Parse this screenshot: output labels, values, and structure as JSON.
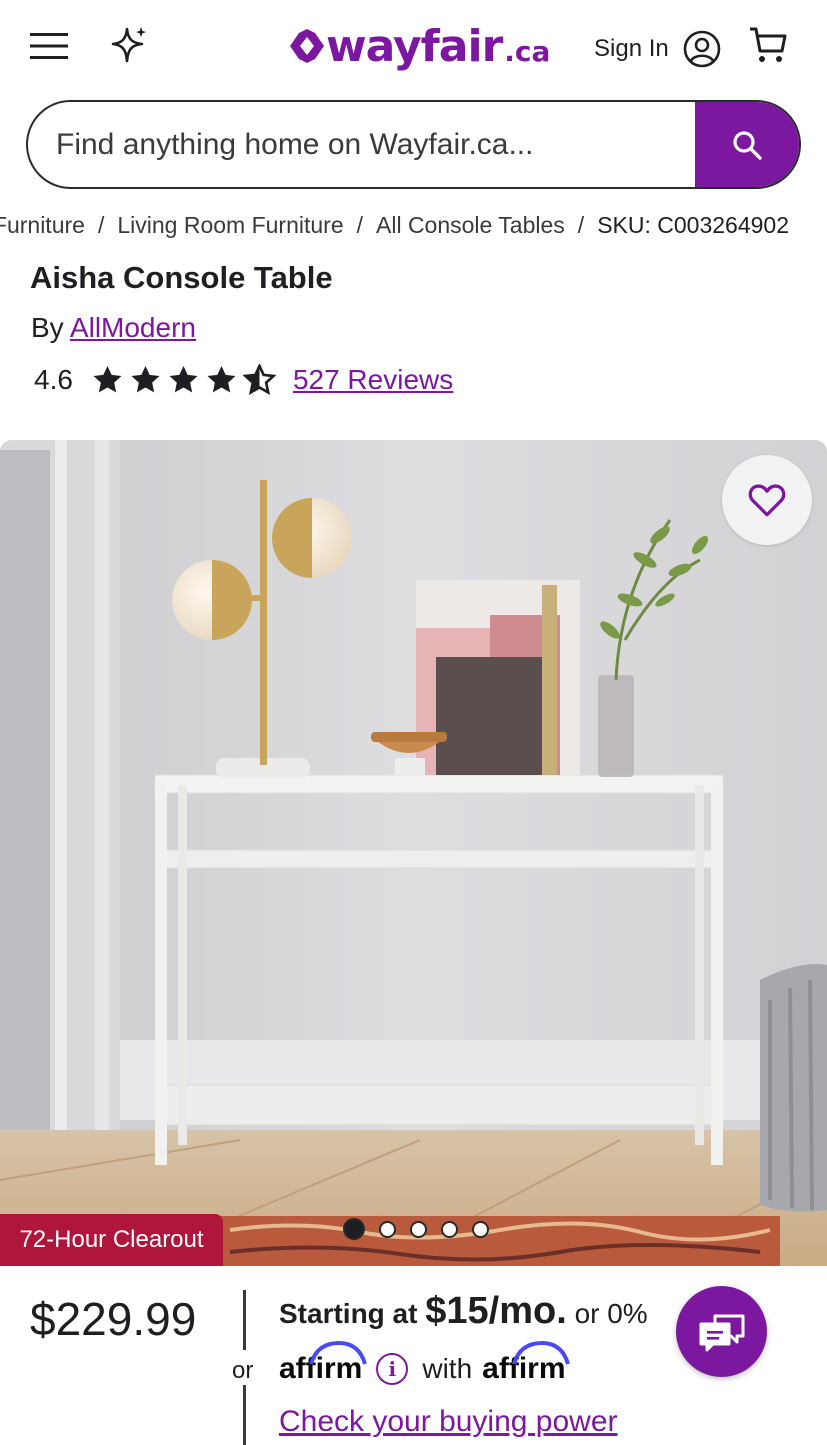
{
  "header": {
    "logo_text": "wayfair",
    "logo_suffix": ".ca",
    "sign_in_label": "Sign In",
    "brand_color": "#7b189f"
  },
  "search": {
    "placeholder": "Find anything home on Wayfair.ca..."
  },
  "breadcrumb": {
    "items": [
      "Furniture",
      "Living Room Furniture",
      "All Console Tables"
    ],
    "sku": "SKU: C003264902"
  },
  "product": {
    "title": "Aisha Console Table",
    "by_label": "By",
    "brand": "AllModern",
    "rating": "4.6",
    "rating_value": 4.6,
    "rating_max": 5,
    "reviews_label": "527 Reviews",
    "badge": "72-Hour Clearout",
    "image_count": 5,
    "active_image": 1
  },
  "pricing": {
    "price": "$229.99",
    "or_label": "or",
    "starting_label": "Starting at",
    "monthly": "$15/mo.",
    "apr_label": "or 0%",
    "affirm_logo": "affirm",
    "with_label": "with",
    "affirm_logo2": "affirm",
    "buying_power_label": "Check your buying power"
  },
  "icons": {
    "menu": "menu-icon",
    "sparkle": "sparkle-icon",
    "account": "account-icon",
    "cart": "cart-icon",
    "search": "search-icon",
    "heart": "heart-icon",
    "chat": "chat-icon",
    "info": "info-icon"
  },
  "colors": {
    "accent": "#7b189f",
    "badge": "#b0163b"
  }
}
